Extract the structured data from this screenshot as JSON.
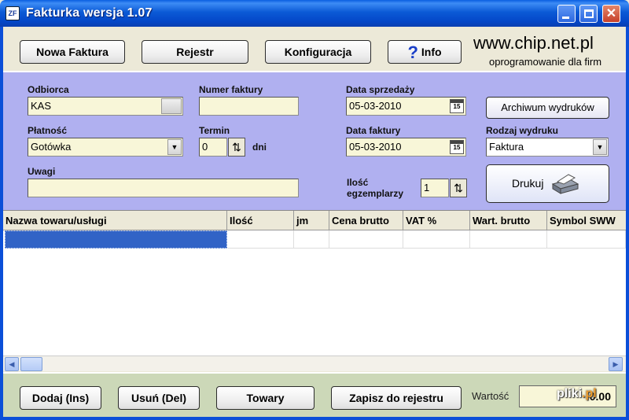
{
  "window": {
    "title": "Fakturka  wersja 1.07",
    "icon_text": "ZF",
    "controls": {
      "minimize": "",
      "maximize": "",
      "close": "✕"
    }
  },
  "toolbar": {
    "new_invoice": "Nowa Faktura",
    "register": "Rejestr",
    "configuration": "Konfiguracja",
    "info": "Info",
    "info_icon": "?"
  },
  "brand": {
    "url": "www.chip.net.pl",
    "subtitle": "oprogramowanie dla firm"
  },
  "form": {
    "recipient": {
      "label": "Odbiorca",
      "value": "KAS"
    },
    "invoice_number": {
      "label": "Numer faktury",
      "value": ""
    },
    "sale_date": {
      "label": "Data sprzedaży",
      "value": "05-03-2010",
      "cal": "15"
    },
    "archive_button": "Archiwum wydruków",
    "payment": {
      "label": "Płatność",
      "value": "Gotówka",
      "arrow": "▼"
    },
    "term": {
      "label": "Termin",
      "value": "0",
      "unit": "dni",
      "spin": "⇅"
    },
    "invoice_date": {
      "label": "Data faktury",
      "value": "05-03-2010",
      "cal": "15"
    },
    "print_type": {
      "label": "Rodzaj wydruku",
      "value": "Faktura",
      "arrow": "▼"
    },
    "notes": {
      "label": "Uwagi",
      "value": ""
    },
    "copies": {
      "label_line1": "Ilość",
      "label_line2": "egzemplarzy",
      "value": "1",
      "spin": "⇅"
    },
    "print_button": "Drukuj"
  },
  "grid": {
    "columns": [
      "Nazwa towaru/usługi",
      "Ilość",
      "jm",
      "Cena brutto",
      "VAT %",
      "Wart. brutto",
      "Symbol SWW"
    ]
  },
  "scrollbar": {
    "left_arrow": "◀",
    "right_arrow": "▶"
  },
  "bottom": {
    "add": "Dodaj (Ins)",
    "remove": "Usuń (Del)",
    "goods": "Towary",
    "save_register": "Zapisz do rejestru",
    "value_label": "Wartość",
    "value": "0.00"
  },
  "watermark": {
    "text": "pliki",
    "suffix": ".pl"
  },
  "colors": {
    "panel": "#b0b0f0",
    "field": "#f8f6d8",
    "selection": "#3163c6",
    "bottom_bar": "#ccd8b8",
    "titlebar": "#0b5ad6"
  }
}
